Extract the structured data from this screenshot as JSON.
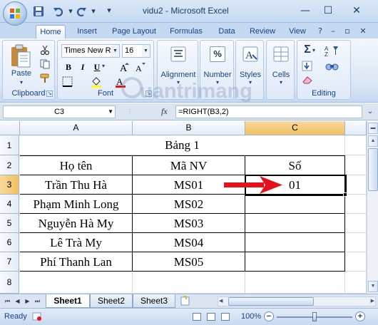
{
  "window": {
    "title": "vidu2 - Microsoft Excel",
    "minimize_glyph": "—",
    "maximize_glyph": "☐",
    "close_glyph": "✕"
  },
  "ribbon_tabs": [
    "Home",
    "Insert",
    "Page Layout",
    "Formulas",
    "Data",
    "Review",
    "View"
  ],
  "ribbon": {
    "clipboard": {
      "label": "Clipboard",
      "paste_label": "Paste"
    },
    "font": {
      "label": "Font",
      "font_name": "Times New Ro",
      "font_size": "16",
      "bold": "B",
      "italic": "I",
      "underline": "U"
    },
    "alignment": {
      "label": "Alignment"
    },
    "number": {
      "label": "Number",
      "glyph": "%"
    },
    "styles": {
      "label": "Styles"
    },
    "cells": {
      "label": "Cells"
    },
    "editing": {
      "label": "Editing",
      "sum_glyph": "Σ"
    }
  },
  "watermark": {
    "text": "uantrimang"
  },
  "formula_bar": {
    "name_box": "C3",
    "fx": "fx",
    "formula": "=RIGHT(B3,2)"
  },
  "grid": {
    "columns": [
      "A",
      "B",
      "C"
    ],
    "rows": [
      "1",
      "2",
      "3",
      "4",
      "5",
      "6",
      "7",
      "8"
    ],
    "selected_cell": "C3",
    "title": "Bảng 1",
    "headers": [
      "Họ tên",
      "Mã NV",
      "Số"
    ],
    "data": [
      [
        "Trần Thu Hà",
        "MS01",
        "01"
      ],
      [
        "Phạm Minh Long",
        "MS02",
        ""
      ],
      [
        "Nguyễn Hà My",
        "MS03",
        ""
      ],
      [
        "Lê Trà My",
        "MS04",
        ""
      ],
      [
        "Phí Thanh Lan",
        "MS05",
        ""
      ]
    ],
    "arrow_color": "#e8101a"
  },
  "sheets": [
    "Sheet1",
    "Sheet2",
    "Sheet3"
  ],
  "active_sheet": "Sheet1",
  "status": {
    "text": "Ready",
    "zoom": "100%",
    "zoom_minus": "−",
    "zoom_plus": "+"
  },
  "colors": {
    "accent": "#15428b",
    "selection_header": "#f1c15f"
  }
}
